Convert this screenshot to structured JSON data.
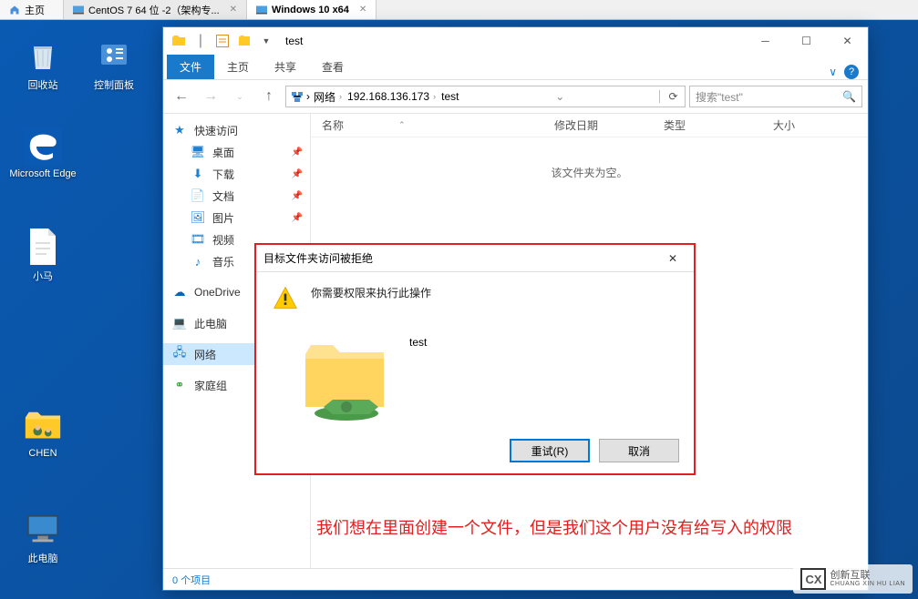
{
  "vm_tabs": {
    "home": "主页",
    "centos": "CentOS 7 64 位 -2（架构专...",
    "windows": "Windows 10 x64"
  },
  "desktop_icons": {
    "recycle": "回收站",
    "cpanel": "控制面板",
    "edge": "Microsoft Edge",
    "xiaoma": "小马",
    "chen": "CHEN",
    "pc": "此电脑"
  },
  "explorer": {
    "title": "test",
    "ribbon": {
      "file": "文件",
      "home": "主页",
      "share": "共享",
      "view": "查看"
    },
    "breadcrumb": {
      "network": "网络",
      "ip": "192.168.136.173",
      "folder": "test"
    },
    "search_placeholder": "搜索\"test\"",
    "columns": {
      "name": "名称",
      "date": "修改日期",
      "type": "类型",
      "size": "大小"
    },
    "empty_msg": "该文件夹为空。",
    "status": "0 个项目"
  },
  "sidebar": {
    "quick": "快速访问",
    "desktop": "桌面",
    "downloads": "下载",
    "documents": "文档",
    "pictures": "图片",
    "videos": "视频",
    "music": "音乐",
    "onedrive": "OneDrive",
    "thispc": "此电脑",
    "network": "网络",
    "homegroup": "家庭组"
  },
  "dialog": {
    "title": "目标文件夹访问被拒绝",
    "message": "你需要权限来执行此操作",
    "folder_name": "test",
    "retry": "重试(R)",
    "cancel": "取消"
  },
  "annotation": "我们想在里面创建一个文件，但是我们这个用户没有给写入的权限",
  "watermark": {
    "brand": "创新互联",
    "sub": "CHUANG XIN HU LIAN"
  }
}
